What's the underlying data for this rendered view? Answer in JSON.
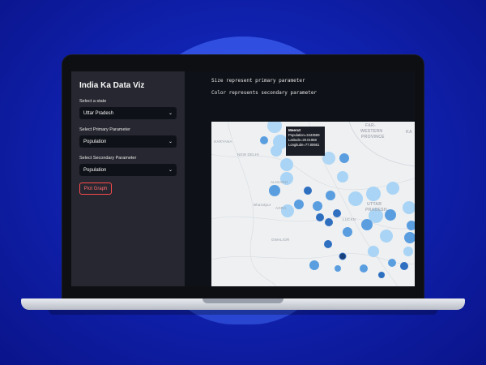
{
  "sidebar": {
    "title": "India Ka Data Viz",
    "state_label": "Select a state",
    "state_value": "Uttar Pradesh",
    "primary_label": "Select Primary Parameter",
    "primary_value": "Population",
    "secondary_label": "Select Secondary Parameter",
    "secondary_value": "Population",
    "plot_button": "Plot Graph"
  },
  "main": {
    "line1": "Size represent primary parameter",
    "line2": "Color represents secondary parameter"
  },
  "tooltip": {
    "title": "Meerut",
    "pop": "Population=3443689",
    "lat": "Latitude=29.01958",
    "lon": "Longitude=77.80661"
  },
  "map_labels": {
    "haryana": "HARYANA",
    "new_delhi": "NEW DELHI",
    "far_western": "FAR-",
    "far_western2": "WESTERN",
    "province": "PROVINCE",
    "aligarh": "ALIGARH",
    "agra": "AGRA",
    "uttar": "UTTAR",
    "pradesh": "PRADESH",
    "gwalior": "GWALIOR",
    "lucknow": "LUCKN",
    "bharatpur": "Bharatpur",
    "ka": "KA"
  },
  "colors": {
    "accent": "#ff4b4b",
    "bubble_light": "#a9d4f5",
    "bubble_mid": "#5a9ee0",
    "bubble_dark": "#2f6fc0"
  }
}
